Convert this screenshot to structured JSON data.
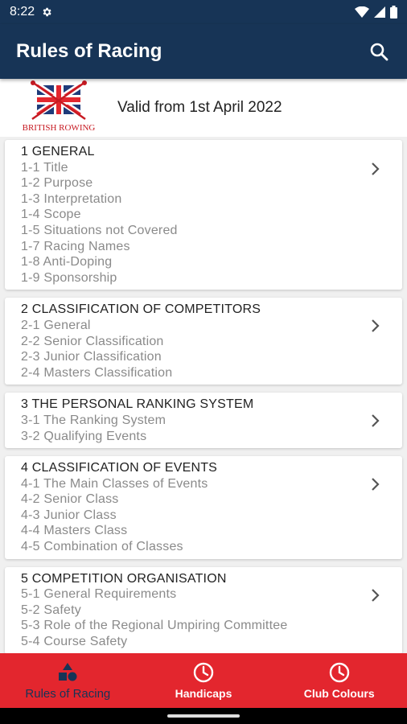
{
  "status_bar": {
    "time": "8:22"
  },
  "app_bar": {
    "title": "Rules of Racing"
  },
  "header": {
    "logo_text": "BRITISH ROWING",
    "valid_text": "Valid from 1st April 2022"
  },
  "sections": [
    {
      "title": "1 GENERAL",
      "items": [
        "1-1 Title",
        "1-2 Purpose",
        "1-3 Interpretation",
        "1-4 Scope",
        "1-5 Situations not Covered",
        "1-7 Racing Names",
        "1-8 Anti-Doping",
        "1-9 Sponsorship"
      ]
    },
    {
      "title": "2 CLASSIFICATION OF COMPETITORS",
      "items": [
        "2-1 General",
        "2-2 Senior Classification",
        "2-3 Junior Classification",
        "2-4 Masters Classification"
      ]
    },
    {
      "title": "3 THE PERSONAL RANKING SYSTEM",
      "items": [
        "3-1 The Ranking System",
        "3-2 Qualifying Events"
      ]
    },
    {
      "title": "4 CLASSIFICATION OF EVENTS",
      "items": [
        "4-1 The Main Classes of Events",
        "4-2 Senior Class",
        "4-3 Junior Class",
        "4-4 Masters Class",
        "4-5 Combination of Classes"
      ]
    },
    {
      "title": "5 COMPETITION ORGANISATION",
      "items": [
        "5-1 General Requirements",
        "5-2 Safety",
        "5-3 Role of the Regional Umpiring Committee",
        "5-4 Course Safety"
      ]
    }
  ],
  "bottom_nav": [
    {
      "label": "Rules of Racing",
      "icon": "shapes-icon",
      "active": true
    },
    {
      "label": "Handicaps",
      "icon": "clock-icon",
      "active": false
    },
    {
      "label": "Club Colours",
      "icon": "clock-icon",
      "active": false
    }
  ],
  "colors": {
    "primary": "#173456",
    "accent": "#e3262e"
  }
}
